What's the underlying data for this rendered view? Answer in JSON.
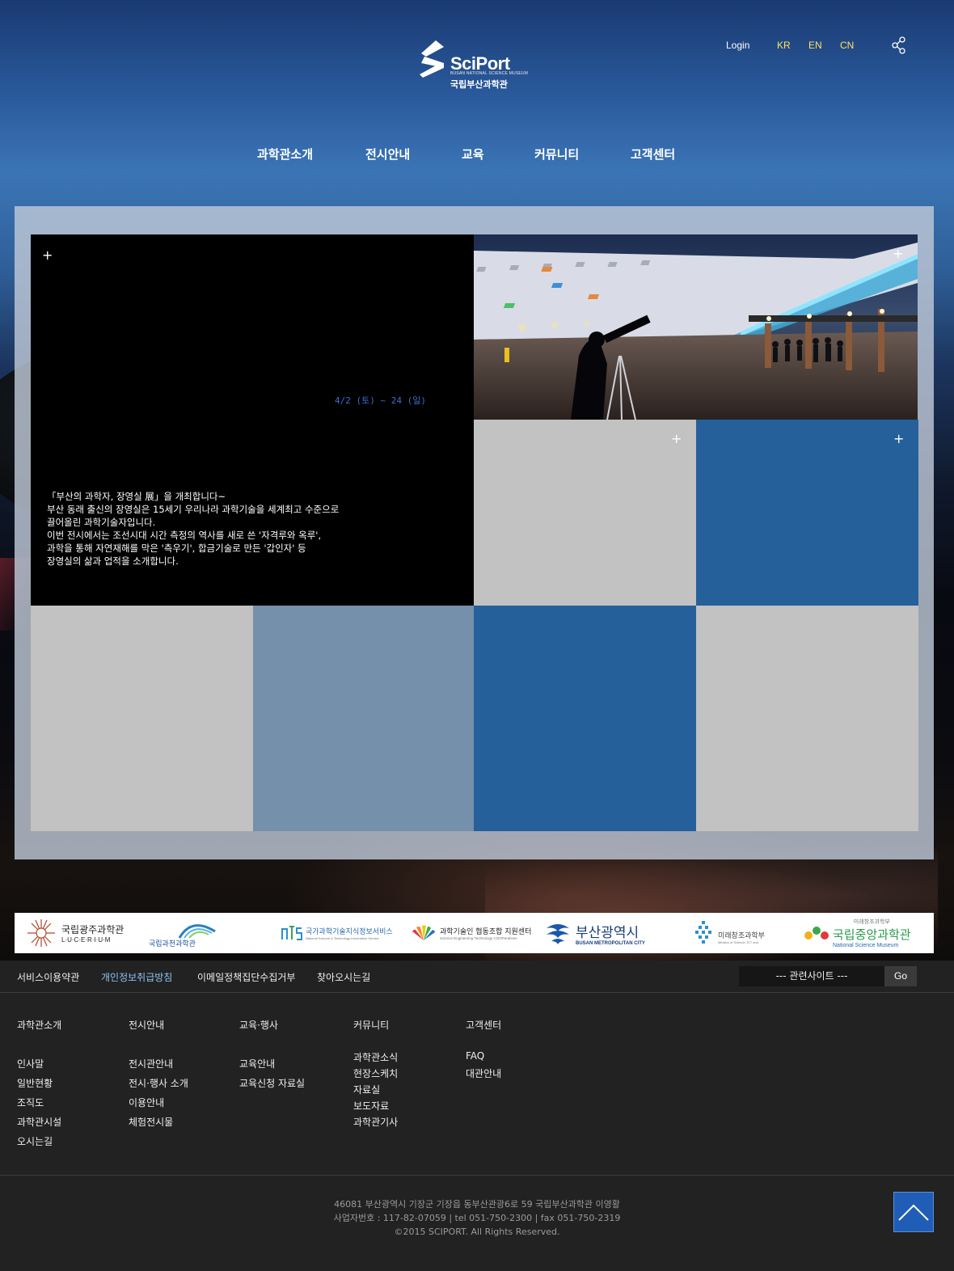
{
  "header": {
    "logo_text": "SciPort",
    "logo_sub": "BUSAN NATIONAL SCIENCE MUSEUM",
    "logo_kr": "국립부산과학관",
    "login": "Login",
    "languages": [
      "KR",
      "EN",
      "CN"
    ]
  },
  "nav": [
    "과학관소개",
    "전시안내",
    "교육",
    "커뮤니티",
    "고객센터"
  ],
  "feature": {
    "date": "4/2 (토) ~ 24 (일)",
    "description": [
      "「부산의 과학자, 장영실 展」을 개최합니다~",
      "부산 동래 출신의 장영실은 15세기 우리나라 과학기술을 세계최고 수준으로",
      "끌어올린  과학기술자입니다.",
      "이번 전시에서는 조선시대 시간 측정의 역사를 새로 쓴 '자격루와 옥루',",
      "과학을 통해 자연재해를 막은 '측우기', 합금기술로 만든 '갑인자' 등",
      "장영실의 삶과 업적을 소개합니다."
    ]
  },
  "plus_symbol": "+",
  "partners": [
    {
      "name": "국립광주과학관",
      "sub": "L·U·C·E·R·I·U·M"
    },
    {
      "name": "국립과천과학관",
      "sub": ""
    },
    {
      "name": "국가과학기술지식정보서비스",
      "sub": "National Science & Technology Information Service"
    },
    {
      "name": "과학기술인 협동조합 지원센터",
      "sub": "Science Engineering Technology COOPeratives"
    },
    {
      "name": "부산광역시",
      "sub": "BUSAN METROPOLITAN CITY"
    },
    {
      "name": "미래창조과학부",
      "sub": "Ministry of Science, ICT and"
    },
    {
      "name": "국립중앙과학관",
      "sub": "National Science Museum",
      "top": "미래창조과학부"
    }
  ],
  "footer": {
    "links": [
      "서비스이용약관",
      "개인정보취급방침",
      "이메일정책집단수집거부",
      "찾아오시는길"
    ],
    "site_select": "---  관련사이트  ---",
    "go": "Go",
    "sitemap": [
      {
        "title": "과학관소개",
        "items": [
          "인사말",
          "일반현황",
          "조직도",
          "과학관시설",
          "오시는길"
        ]
      },
      {
        "title": "전시안내",
        "items": [
          "전시관안내",
          "전시·행사 소개",
          "이용안내",
          "체험전시물"
        ]
      },
      {
        "title": "교육·행사",
        "items": [
          "교육안내",
          "교육신청 자료실"
        ]
      },
      {
        "title": "커뮤니티",
        "items": [
          "과학관소식",
          "현장스케치",
          "자료실",
          "보도자료",
          "과학관기사"
        ]
      },
      {
        "title": "고객센터",
        "items": [
          "FAQ",
          "대관안내"
        ]
      }
    ],
    "address": "46081 부산광역시 기장군 기장읍 동부산관광6로 59 국립부산과학관 이영활",
    "business": "사업자번호 : 117-82-07059 | tel 051-750-2300 | fax 051-750-2319",
    "copyright": "©2015 SCIPORT. All Rights Reserved."
  },
  "colors": {
    "tile_gray": "#c2c2c2",
    "tile_blue": "#25609a",
    "tile_slate": "#7590aa",
    "lang_yellow": "#ffe25a",
    "link_highlight": "#8cc3f2",
    "top_button": "#1f5db7"
  }
}
